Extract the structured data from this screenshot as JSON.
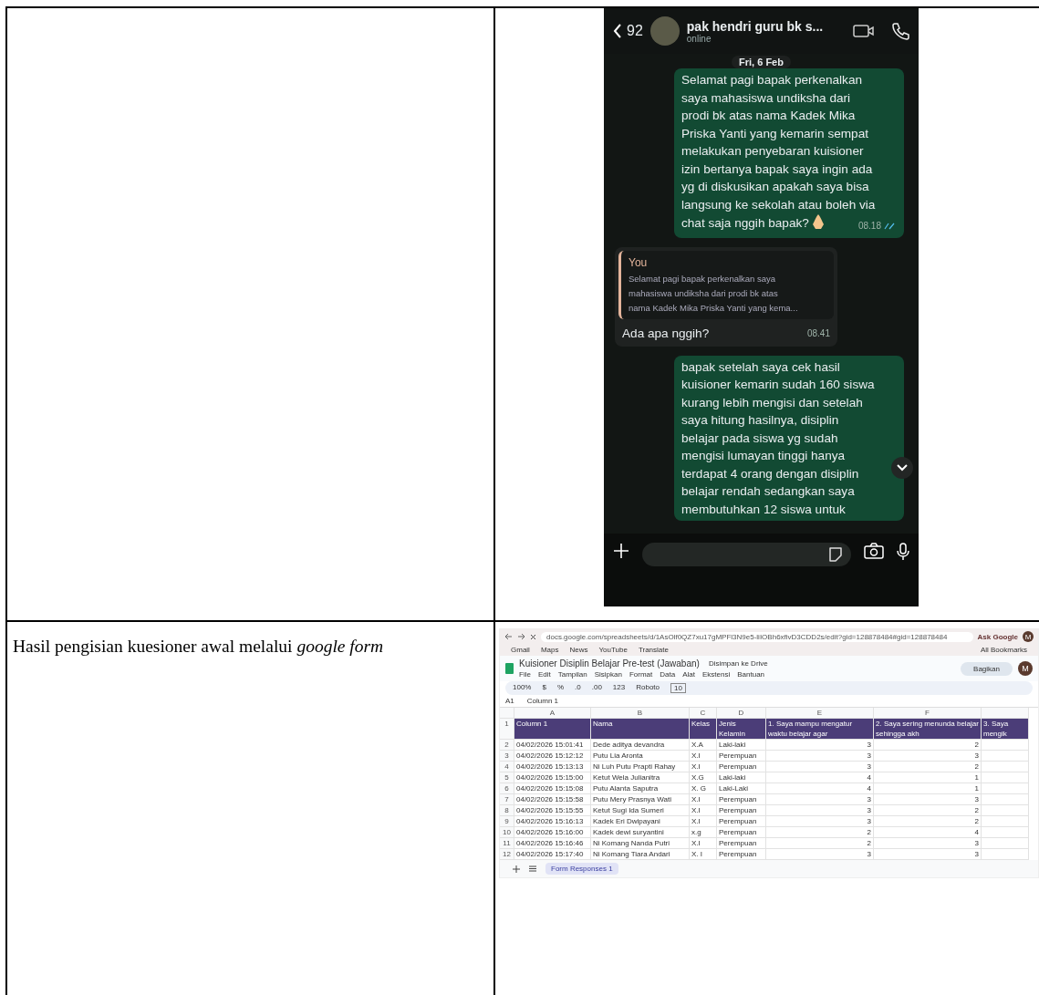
{
  "chat": {
    "back_count": "92",
    "contact_name": "pak hendri guru bk s...",
    "contact_status": "online",
    "date": "Fri, 6 Feb",
    "messages": [
      {
        "kind": "outgoing",
        "text": "Selamat pagi bapak perkenalkan\nsaya mahasiswa undiksha dari\nprodi bk atas nama Kadek Mika\nPriska Yanti yang kemarin sempat\nmelakukan penyebaran kuisioner\nizin bertanya bapak saya ingin ada\nyg di diskusikan apakah saya bisa\nlangsung ke sekolah atau boleh via\nchat saja nggih bapak?",
        "emoji": true,
        "time": "08.18",
        "read": true
      },
      {
        "kind": "incoming",
        "quote_author": "You",
        "quote_text": "Selamat pagi bapak perkenalkan saya\nmahasiswa undiksha dari prodi bk atas\nnama Kadek Mika Priska Yanti yang kema...",
        "text": "Ada apa nggih?",
        "time": "08.41"
      },
      {
        "kind": "outgoing",
        "text": "bapak setelah saya cek hasil\nkuisioner kemarin sudah 160 siswa\nkurang lebih mengisi dan setelah\nsaya hitung hasilnya, disiplin\nbelajar pada siswa yg sudah\nmengisi lumayan tinggi hanya\nterdapat 4 orang dengan  disiplin\nbelajar rendah sedangkan saya\nmembutuhkan 12 siswa untuk"
      }
    ]
  },
  "caption": "Hasil pengisian kuesioner awal melalui *google form*",
  "sheet": {
    "url": "docs.google.com/spreadsheets/d/1AsOlf0QZ7xu17gMPFl3N9e5-liIOBh6xfivD3CDD2s/edit?gid=128878484#gid=128878484",
    "ask": "Ask Google",
    "profile": "M",
    "bookmarks": [
      "Gmail",
      "Maps",
      "News",
      "YouTube",
      "Translate"
    ],
    "all_bookmarks": "All Bookmarks",
    "doc_profile": "M",
    "title": "Kuisioner Disiplin Belajar Pre-test (Jawaban)",
    "saved": "Disimpan ke Drive",
    "menus": [
      "File",
      "Edit",
      "Tampilan",
      "Sisipkan",
      "Format",
      "Data",
      "Alat",
      "Ekstensi",
      "Bantuan"
    ],
    "share": "Bagikan",
    "zoom": "100%",
    "toolbar_texts": [
      "$",
      "%",
      ".0",
      ".00",
      "123"
    ],
    "font": "Roboto",
    "font_size": "10",
    "cell_ref": "A1",
    "formula": "Column 1",
    "column_letters": [
      "A",
      "B",
      "C",
      "D",
      "E",
      "F"
    ],
    "header_row": "1",
    "columns": [
      "Column 1",
      "Nama",
      "Kelas",
      "Jenis Kelamin",
      "1. Saya mampu mengatur waktu belajar agar",
      "2. Saya sering menunda belajar sehingga akh",
      "3. Saya mengik"
    ],
    "rows": [
      {
        "num": "2",
        "cells": [
          "04/02/2026 15:01:41",
          "Dede aditya devandra",
          "X.A",
          "Laki-laki",
          "3",
          "2"
        ]
      },
      {
        "num": "3",
        "cells": [
          "04/02/2026 15:12:12",
          "Putu Lia Aronta",
          "X.I",
          "Perempuan",
          "3",
          "3"
        ]
      },
      {
        "num": "4",
        "cells": [
          "04/02/2026 15:13:13",
          "Ni Luh Putu Prapti Rahay",
          "X.I",
          "Perempuan",
          "3",
          "2"
        ]
      },
      {
        "num": "5",
        "cells": [
          "04/02/2026 15:15:00",
          "Ketut Wela Julianitra",
          "X.G",
          "Laki-laki",
          "4",
          "1"
        ]
      },
      {
        "num": "6",
        "cells": [
          "04/02/2026 15:15:08",
          "Putu Alanta Saputra",
          "X. G",
          "Laki-Laki",
          "4",
          "1"
        ]
      },
      {
        "num": "7",
        "cells": [
          "04/02/2026 15:15:58",
          "Putu Mery Prasnya Wati",
          "X.I",
          "Perempuan",
          "3",
          "3"
        ]
      },
      {
        "num": "8",
        "cells": [
          "04/02/2026 15:15:55",
          "Ketut Sugi Ida Sumeri",
          "X.I",
          "Perempuan",
          "3",
          "2"
        ]
      },
      {
        "num": "9",
        "cells": [
          "04/02/2026 15:16:13",
          "Kadek Eri Dwipayani",
          "X.I",
          "Perempuan",
          "3",
          "2"
        ]
      },
      {
        "num": "10",
        "cells": [
          "04/02/2026 15:16:00",
          "Kadek dewi suryantini",
          "x.g",
          "Perempuan",
          "2",
          "4"
        ]
      },
      {
        "num": "11",
        "cells": [
          "04/02/2026 15:16:46",
          "Ni Komang Nanda Putri",
          "X.I",
          "Perempuan",
          "2",
          "3"
        ]
      },
      {
        "num": "12",
        "cells": [
          "04/02/2026 15:17:40",
          "Ni Komang Tiara Andari",
          "X. I",
          "Perempuan",
          "3",
          "3"
        ]
      }
    ],
    "sheet_tab": {
      "label": "Form Responses 1",
      "selected": true
    }
  }
}
